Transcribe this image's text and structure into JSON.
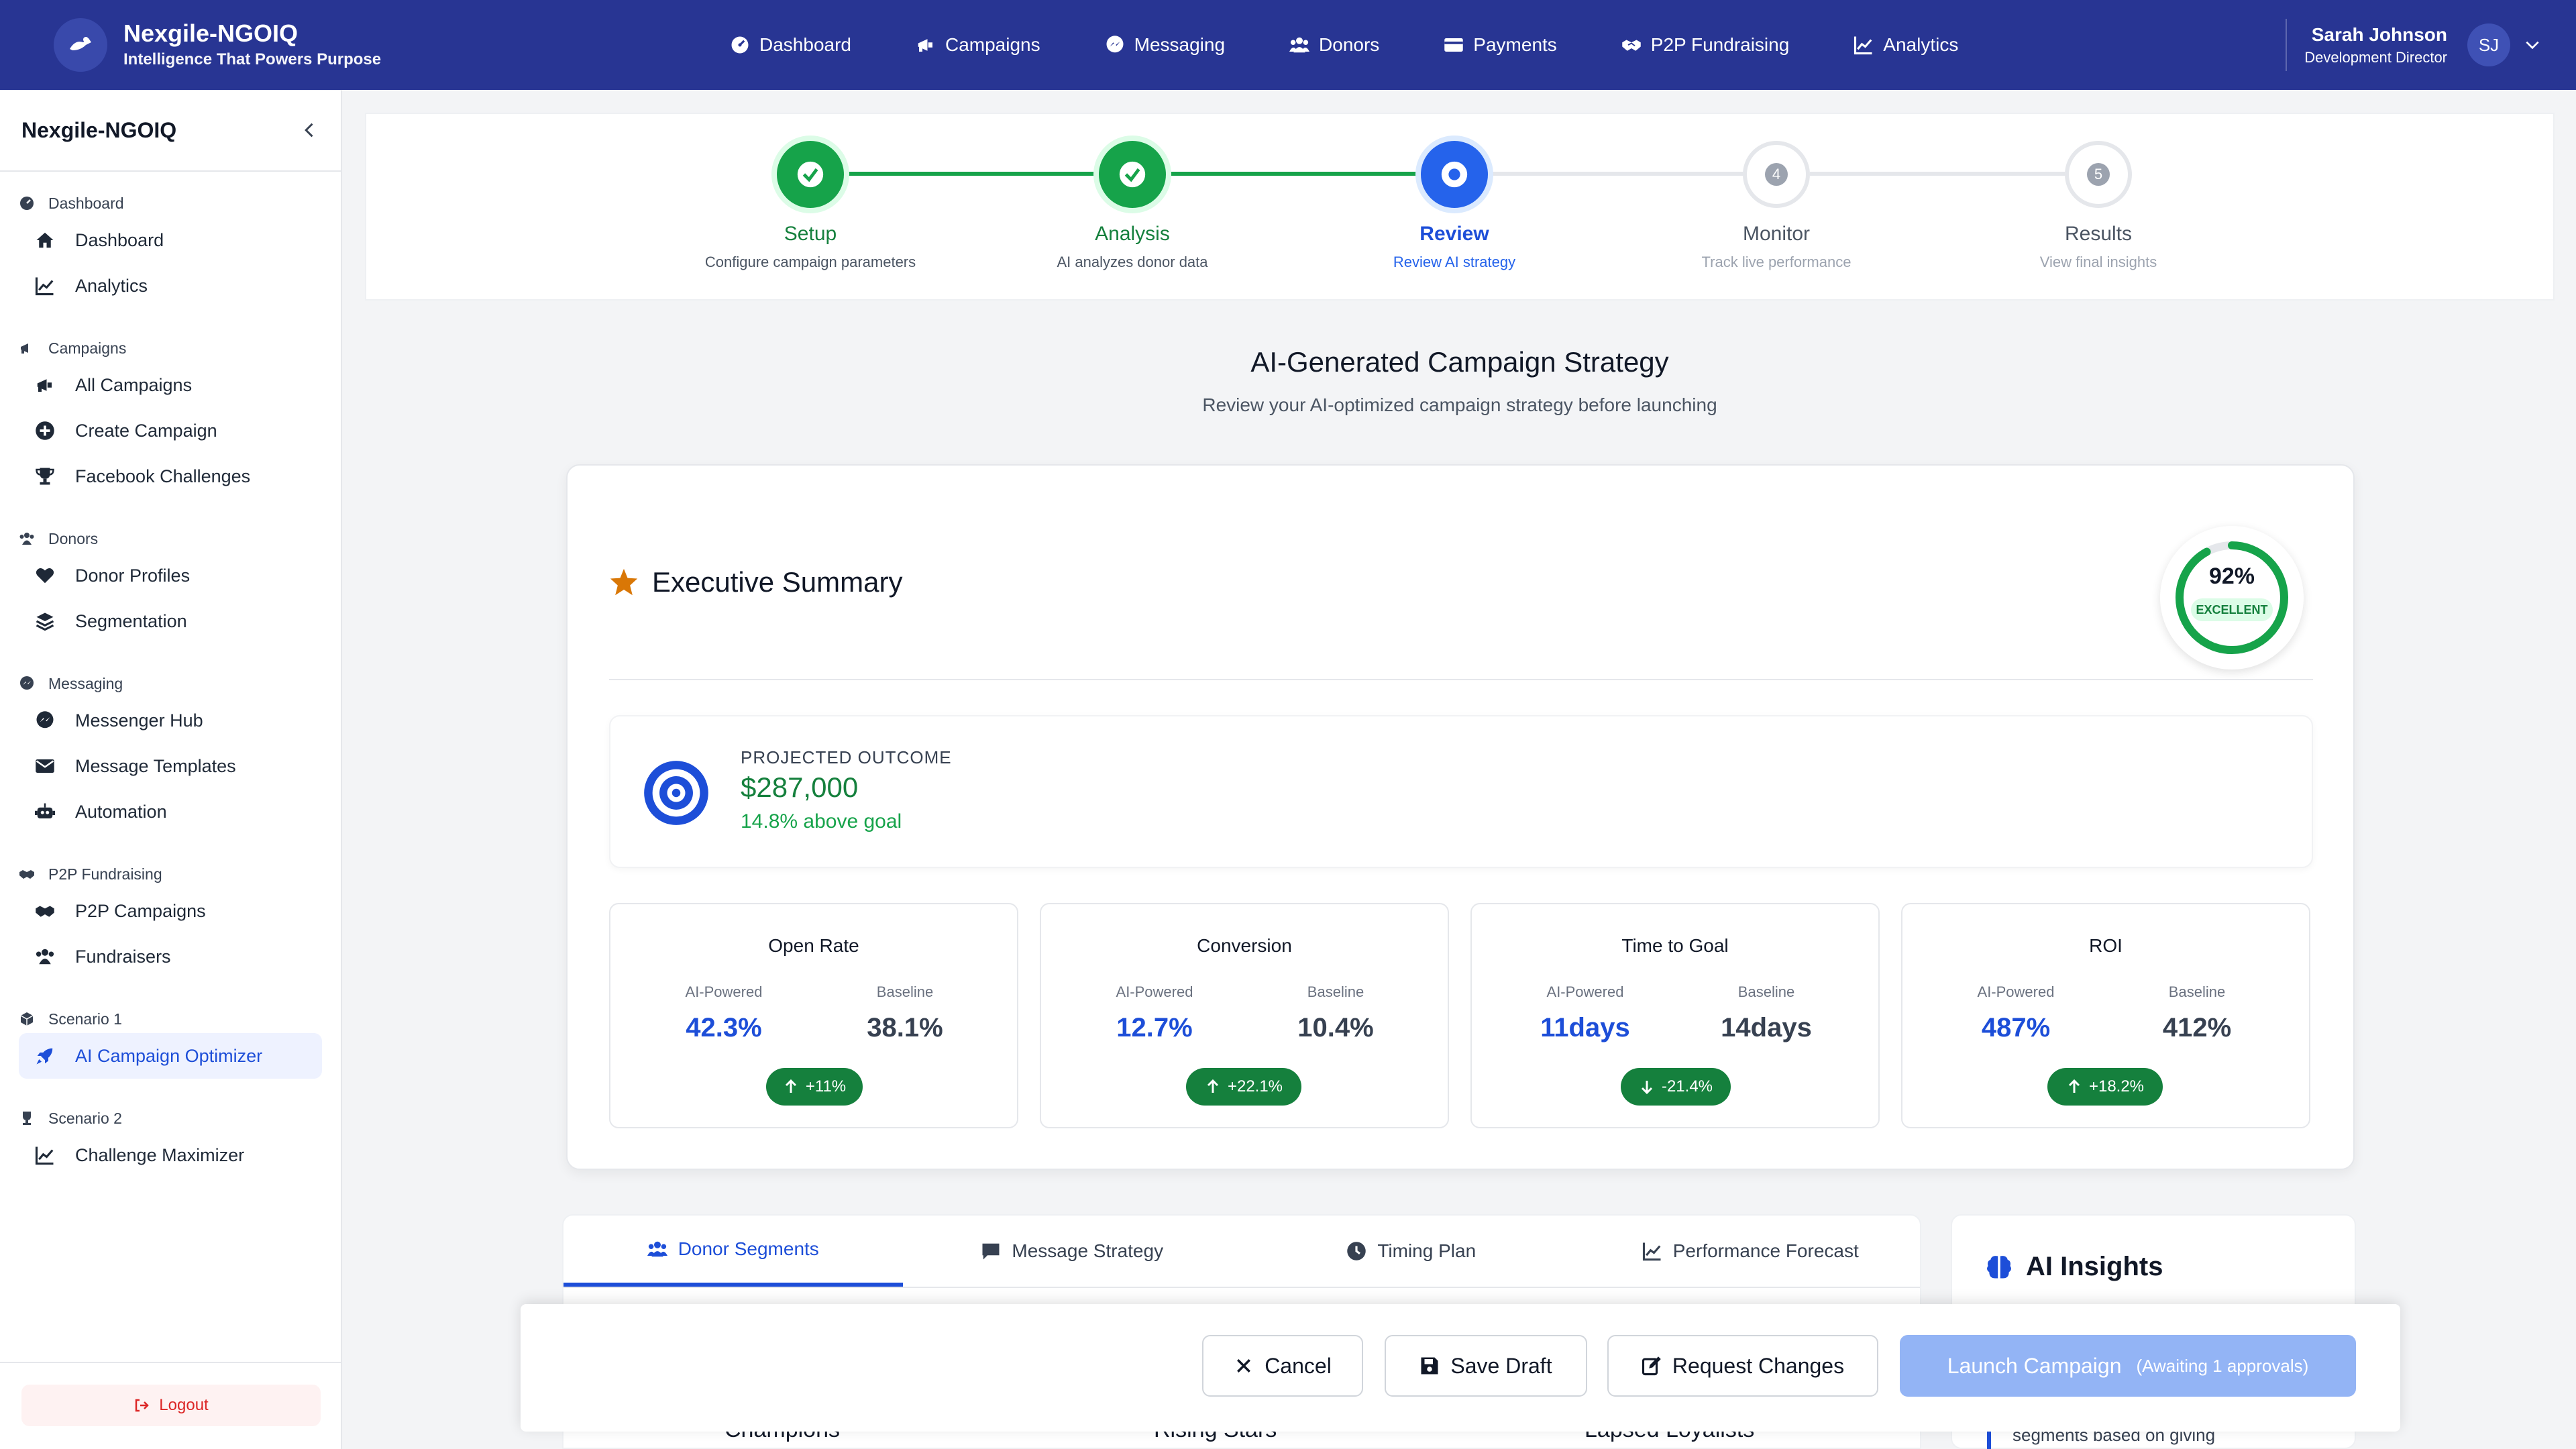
{
  "app": {
    "name": "Nexgile-NGOIQ",
    "tagline": "Intelligence That Powers Purpose"
  },
  "topnav": [
    {
      "label": "Dashboard",
      "icon": "dashboard-icon"
    },
    {
      "label": "Campaigns",
      "icon": "megaphone-icon"
    },
    {
      "label": "Messaging",
      "icon": "messenger-icon"
    },
    {
      "label": "Donors",
      "icon": "users-icon"
    },
    {
      "label": "Payments",
      "icon": "credit-card-icon"
    },
    {
      "label": "P2P Fundraising",
      "icon": "handshake-icon"
    },
    {
      "label": "Analytics",
      "icon": "chart-line-icon"
    }
  ],
  "user": {
    "name": "Sarah Johnson",
    "role": "Development Director",
    "initials": "SJ"
  },
  "sidebar": {
    "title": "Nexgile-NGOIQ",
    "sections": [
      {
        "label": "Dashboard",
        "items": [
          "Dashboard",
          "Analytics"
        ]
      },
      {
        "label": "Campaigns",
        "items": [
          "All Campaigns",
          "Create Campaign",
          "Facebook Challenges"
        ]
      },
      {
        "label": "Donors",
        "items": [
          "Donor Profiles",
          "Segmentation"
        ]
      },
      {
        "label": "Messaging",
        "items": [
          "Messenger Hub",
          "Message Templates",
          "Automation"
        ]
      },
      {
        "label": "P2P Fundraising",
        "items": [
          "P2P Campaigns",
          "Fundraisers"
        ]
      },
      {
        "label": "Scenario 1",
        "items": [
          "AI Campaign Optimizer"
        ]
      },
      {
        "label": "Scenario 2",
        "items": [
          "Challenge Maximizer"
        ]
      }
    ],
    "logout": "Logout"
  },
  "stepper": [
    {
      "title": "Setup",
      "sub": "Configure campaign parameters",
      "state": "done",
      "num": ""
    },
    {
      "title": "Analysis",
      "sub": "AI analyzes donor data",
      "state": "done",
      "num": ""
    },
    {
      "title": "Review",
      "sub": "Review AI strategy",
      "state": "current",
      "num": ""
    },
    {
      "title": "Monitor",
      "sub": "Track live performance",
      "state": "todo",
      "num": "4"
    },
    {
      "title": "Results",
      "sub": "View final insights",
      "state": "todo",
      "num": "5"
    }
  ],
  "section": {
    "title": "AI-Generated Campaign Strategy",
    "subtitle": "Review your AI-optimized campaign strategy before launching"
  },
  "executive": {
    "title": "Executive Summary",
    "score": "92%",
    "score_label": "EXCELLENT",
    "score_fraction": 0.92,
    "outcome_label": "PROJECTED OUTCOME",
    "outcome_value": "$287,000",
    "outcome_note": "14.8% above goal"
  },
  "metrics": [
    {
      "title": "Open Rate",
      "ai_label": "AI-Powered",
      "base_label": "Baseline",
      "ai": "42.3%",
      "base": "38.1%",
      "delta": "+11%",
      "dir": "up"
    },
    {
      "title": "Conversion",
      "ai_label": "AI-Powered",
      "base_label": "Baseline",
      "ai": "12.7%",
      "base": "10.4%",
      "delta": "+22.1%",
      "dir": "up"
    },
    {
      "title": "Time to Goal",
      "ai_label": "AI-Powered",
      "base_label": "Baseline",
      "ai": "11days",
      "base": "14days",
      "delta": "-21.4%",
      "dir": "down"
    },
    {
      "title": "ROI",
      "ai_label": "AI-Powered",
      "base_label": "Baseline",
      "ai": "487%",
      "base": "412%",
      "delta": "+18.2%",
      "dir": "up"
    }
  ],
  "tabs": [
    {
      "label": "Donor Segments",
      "icon": "users-icon"
    },
    {
      "label": "Message Strategy",
      "icon": "message-icon"
    },
    {
      "label": "Timing Plan",
      "icon": "clock-icon"
    },
    {
      "label": "Performance Forecast",
      "icon": "chart-line-icon"
    }
  ],
  "segments": [
    "Champions",
    "Rising Stars",
    "Lapsed Loyalists"
  ],
  "insights": {
    "title": "AI Insights",
    "text": "segments based on giving"
  },
  "actions": {
    "cancel": "Cancel",
    "save": "Save Draft",
    "request": "Request Changes",
    "launch": "Launch Campaign",
    "launch_note": "(Awaiting 1 approvals)"
  },
  "colors": {
    "topbar": "#283593",
    "done": "#16a34a",
    "current": "#2563eb",
    "accent_blue": "#1d4ed8"
  }
}
